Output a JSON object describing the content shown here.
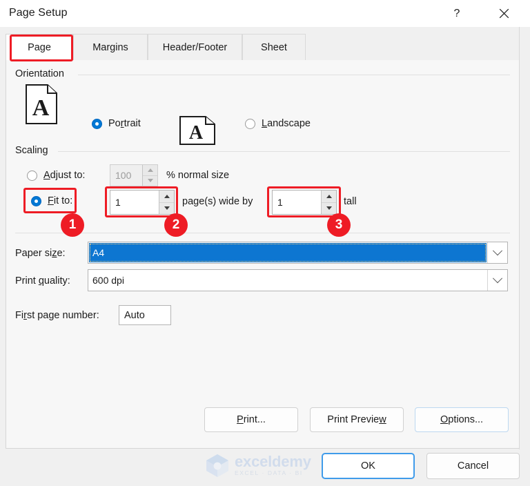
{
  "window": {
    "title": "Page Setup",
    "help_icon": "question-mark-icon",
    "close_icon": "close-icon"
  },
  "tabs": [
    {
      "label": "Page",
      "active": true
    },
    {
      "label": "Margins",
      "active": false
    },
    {
      "label": "Header/Footer",
      "active": false
    },
    {
      "label": "Sheet",
      "active": false
    }
  ],
  "orientation": {
    "group_label": "Orientation",
    "portrait": {
      "label": "Portrait",
      "mnemonic": "r",
      "checked": true,
      "icon": "portrait-page-icon"
    },
    "landscape": {
      "label": "Landscape",
      "mnemonic": "L",
      "checked": false,
      "icon": "landscape-page-icon"
    },
    "page_glyph": "A"
  },
  "scaling": {
    "group_label": "Scaling",
    "adjust_to": {
      "label": "Adjust to:",
      "mnemonic": "A",
      "checked": false,
      "value": "100",
      "suffix": "% normal size",
      "disabled": true
    },
    "fit_to": {
      "label": "Fit to:",
      "mnemonic": "F",
      "checked": true,
      "wide_value": "1",
      "middle_text": "page(s) wide by",
      "tall_value": "1",
      "suffix": "tall"
    }
  },
  "paper": {
    "paper_size_label": "Paper size:",
    "paper_size_value": "A4",
    "print_quality_label": "Print quality:",
    "print_quality_value": "600 dpi",
    "first_page_label": "First page number:",
    "first_page_value": "Auto"
  },
  "buttons": {
    "print": "Print...",
    "print_preview": "Print Preview",
    "options": "Options...",
    "ok": "OK",
    "cancel": "Cancel"
  },
  "annotations": {
    "badge_1": "1",
    "badge_2": "2",
    "badge_3": "3",
    "highlight_color": "#ee1c25"
  },
  "watermark": {
    "name": "exceldemy",
    "tagline": "EXCEL · DATA · BI",
    "icon": "cube-logo-icon"
  }
}
